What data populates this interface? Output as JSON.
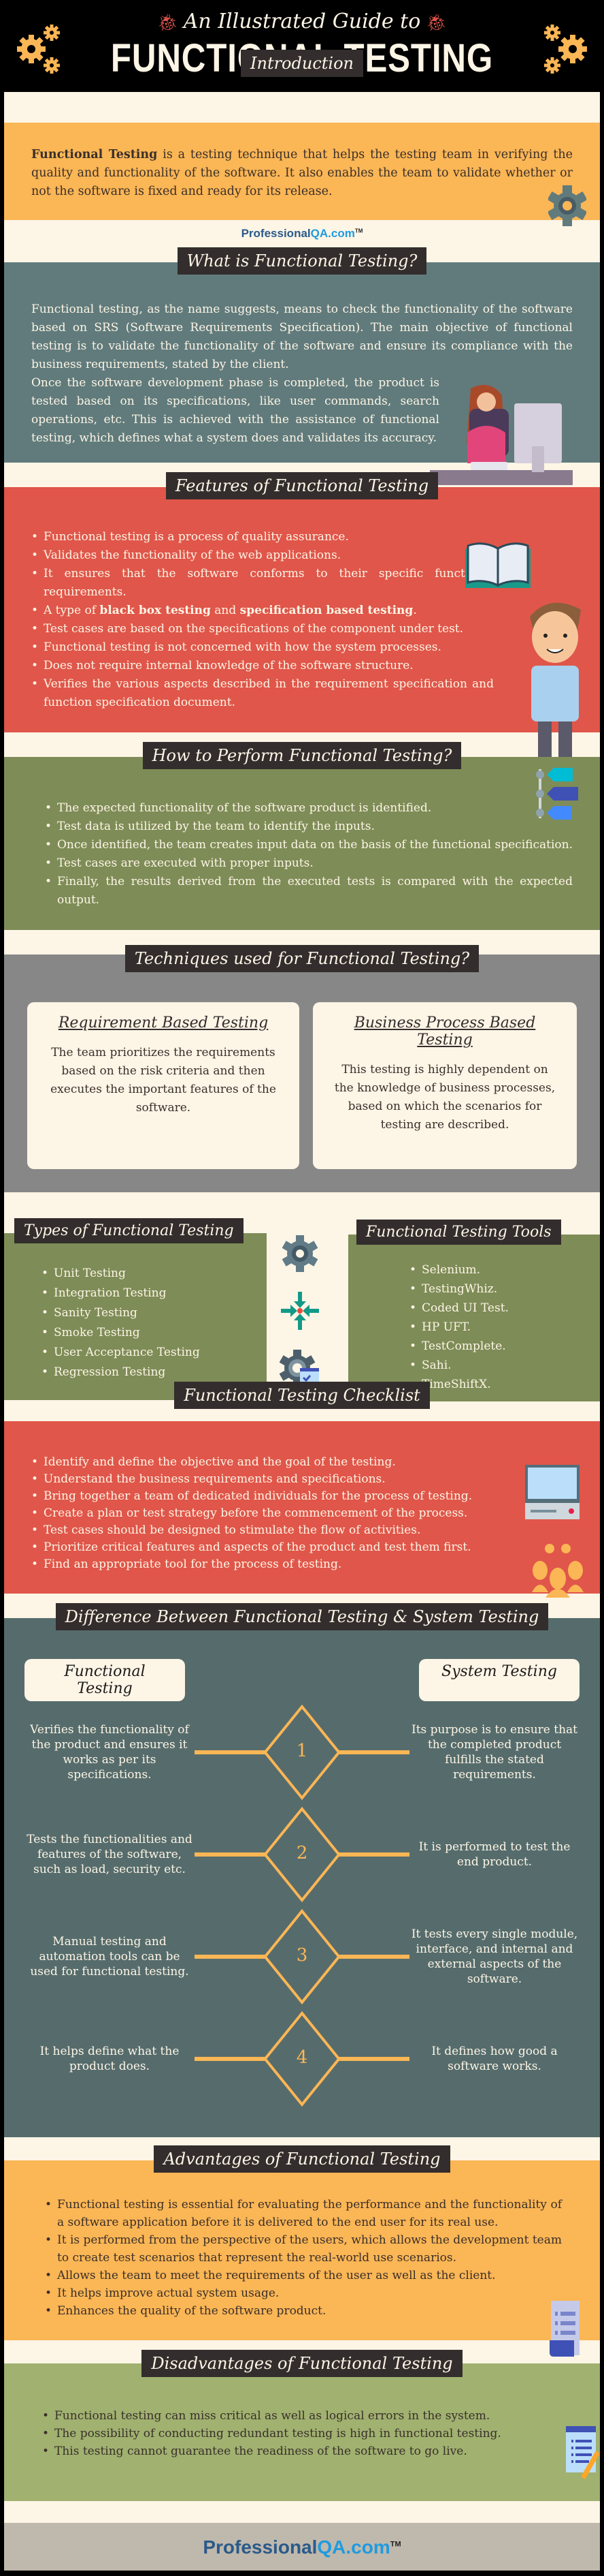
{
  "header": {
    "subtitle": "An Illustrated Guide to",
    "title": "FUNCTIONAL TESTING"
  },
  "intro": {
    "heading": "Introduction",
    "bold_lead": "Functional Testing",
    "text": " is a testing technique that helps the testing team in verifying the quality and functionality of the software. It also enables the team to validate whether or not the software is fixed and ready for its release."
  },
  "logo": {
    "main": "Professional",
    "accent": "QA.com",
    "tm": "TM"
  },
  "what": {
    "heading": "What is Functional Testing?",
    "para1": "Functional testing, as the name suggests, means to check the functionality of the software based on SRS (Software Requirements Specification). The main objective of functional testing is to validate the functionality of the software and ensure its compliance with the business requirements, stated by the client.",
    "para2": "Once the software development phase is completed, the product is tested based on its specifications, like user commands, search operations, etc. This is achieved with the assistance of functional testing, which defines what a system does and validates its accuracy."
  },
  "features": {
    "heading": "Features of Functional Testing",
    "items": [
      "Functional testing is a process of quality assurance.",
      "Validates the functionality of the web applications.",
      "It ensures that the software conforms to their specific functional requirements.",
      "A type of black box testing and specification based testing.",
      "Test cases are based on the specifications of the component under test.",
      "Functional testing is not concerned with how the system processes.",
      "Does not require internal knowledge of the software structure.",
      "Verifies the various aspects described in the requirement specification and function specification document."
    ],
    "item3_parts": {
      "pre": "A type of ",
      "b1": "black box testing",
      "mid": " and ",
      "b2": "specification based testing",
      "post": "."
    }
  },
  "how": {
    "heading": "How to Perform Functional Testing?",
    "items": [
      "The expected functionality of the software product is identified.",
      "Test data is utilized by the team to identify the inputs.",
      "Once identified, the team creates input data on the basis of the functional specification.",
      "Test cases are executed with proper inputs.",
      "Finally, the results derived from the executed tests is compared with the expected output."
    ]
  },
  "techniques": {
    "heading": "Techniques used for Functional Testing?",
    "cards": [
      {
        "title": "Requirement Based Testing",
        "text": "The team prioritizes the requirements based on the risk criteria and then executes the important features of the software."
      },
      {
        "title": "Business Process Based Testing",
        "text": "This testing is highly dependent on the knowledge of business processes, based on which the scenarios for testing are described."
      }
    ]
  },
  "types": {
    "heading": "Types of Functional Testing",
    "items": [
      "Unit Testing",
      "Integration Testing",
      "Sanity Testing",
      "Smoke Testing",
      "User Acceptance Testing",
      "Regression Testing"
    ]
  },
  "tools": {
    "heading": "Functional Testing Tools",
    "items": [
      "Selenium.",
      "TestingWhiz.",
      "Coded UI Test.",
      "HP UFT.",
      "TestComplete.",
      "Sahi.",
      "TimeShiftX."
    ]
  },
  "checklist": {
    "heading": "Functional Testing Checklist",
    "items": [
      "Identify and define the objective and the goal of the testing.",
      "Understand the business requirements and specifications.",
      "Bring together a team of dedicated individuals for the process of testing.",
      "Create a plan or test strategy before the commencement of the process.",
      "Test cases should be designed to stimulate the flow of activities.",
      "Prioritize critical features and aspects of the product and test them first.",
      "Find an appropriate tool for the process of testing."
    ]
  },
  "difference": {
    "heading": "Difference Between Functional Testing & System Testing",
    "left_title": "Functional Testing",
    "right_title": "System Testing",
    "rows": [
      {
        "num": "1",
        "left": "Verifies the functionality of the product and ensures it works as per its specifications.",
        "right": "Its purpose is to ensure that the completed product fulfills the stated requirements."
      },
      {
        "num": "2",
        "left": "Tests the functionalities and features of the software, such as load, security etc.",
        "right": "It is performed to test the end product."
      },
      {
        "num": "3",
        "left": "Manual testing and automation tools can be used for functional testing.",
        "right": "It tests every single module, interface, and internal and external aspects of the software."
      },
      {
        "num": "4",
        "left": "It helps define what the product does.",
        "right": "It defines how good a software works."
      }
    ]
  },
  "advantages": {
    "heading": "Advantages of Functional Testing",
    "items": [
      "Functional testing is essential for evaluating the performance and the functionality of a software application before it is delivered to the end user for its real use.",
      "It is performed from the perspective of the users, which allows the development team to create test scenarios that represent the real-world use scenarios.",
      "Allows the team to meet the requirements of the user as well as the client.",
      "It helps improve actual system usage.",
      "Enhances the quality of the software product."
    ]
  },
  "disadvantages": {
    "heading": "Disadvantages of Functional Testing",
    "items": [
      "Functional testing can miss critical as well as logical errors in the system.",
      "The possibility of conducting redundant testing is high in functional testing.",
      "This testing cannot guarantee the readiness of the software to go live."
    ]
  },
  "colors": {
    "cream": "#fdf5e6",
    "orange": "#fbb655",
    "slate": "#617b7c",
    "red": "#e0564a",
    "olive": "#7e8c57",
    "gray": "#878787",
    "dark": "#332d2d"
  }
}
